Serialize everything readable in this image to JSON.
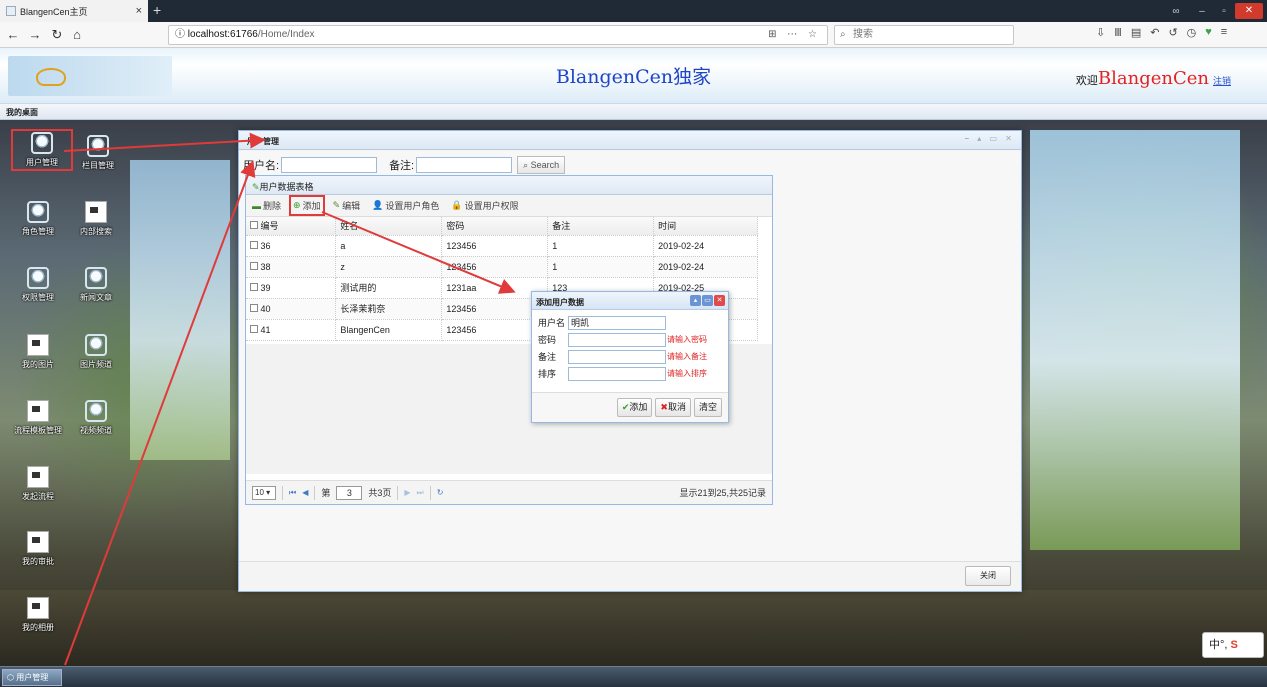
{
  "browser": {
    "tab_title": "BlangenCen主页",
    "url_host": "localhost",
    "url_port": ":61766",
    "url_path": "/Home/Index",
    "search_placeholder": "搜索"
  },
  "site": {
    "title": "BlangenCen独家",
    "welcome_prefix": "欢迎",
    "username": "BlangenCen",
    "logout": "注销",
    "desktop_label": "我的桌面"
  },
  "desktop_icons": [
    {
      "label": "用户管理",
      "icon": "cube-icon"
    },
    {
      "label": "栏目管理",
      "icon": "cube-icon"
    },
    {
      "label": "角色管理",
      "icon": "cube-icon"
    },
    {
      "label": "内部搜索",
      "icon": "document-icon"
    },
    {
      "label": "权限管理",
      "icon": "cube-icon"
    },
    {
      "label": "新闻文章",
      "icon": "cube-icon"
    },
    {
      "label": "我的图片",
      "icon": "document-icon"
    },
    {
      "label": "图片频道",
      "icon": "cube-icon"
    },
    {
      "label": "流程模板管理",
      "icon": "document-icon"
    },
    {
      "label": "视频频道",
      "icon": "cube-icon"
    },
    {
      "label": "发起流程",
      "icon": "document-icon"
    },
    {
      "label": "我的审批",
      "icon": "document-icon"
    },
    {
      "label": "我的相册",
      "icon": "document-icon"
    }
  ],
  "window": {
    "title": "用户管理",
    "search": {
      "username_label": "用户名:",
      "remark_label": "备注:",
      "search_button": "Search"
    },
    "grid": {
      "title": "用户数据表格",
      "toolbar": {
        "delete": "删除",
        "add": "添加",
        "edit": "编辑",
        "set_role": "设置用户角色",
        "set_permission": "设置用户权限"
      },
      "columns": [
        "编号",
        "姓名",
        "密码",
        "备注",
        "时间"
      ],
      "rows": [
        [
          "36",
          "a",
          "123456",
          "1",
          "2019-02-24"
        ],
        [
          "38",
          "z",
          "123456",
          "1",
          "2019-02-24"
        ],
        [
          "39",
          "测试用的",
          "1231aa",
          "123",
          "2019-02-25"
        ],
        [
          "40",
          "长泽茉莉奈",
          "123456",
          "",
          ""
        ],
        [
          "41",
          "BlangenCen",
          "123456",
          "",
          ""
        ]
      ],
      "pager": {
        "page_size": "10",
        "page_label": "第",
        "page": "3",
        "total_pages": "共3页",
        "info": "显示21到25,共25记录"
      }
    },
    "close_button": "关闭"
  },
  "dialog": {
    "title": "添加用户数据",
    "fields": [
      {
        "label": "用户名",
        "value": "明凯",
        "error": ""
      },
      {
        "label": "密码",
        "value": "",
        "error": "请输入密码"
      },
      {
        "label": "备注",
        "value": "",
        "error": "请输入备注"
      },
      {
        "label": "排序",
        "value": "",
        "error": "请输入排序"
      }
    ],
    "buttons": {
      "add": "添加",
      "cancel": "取消",
      "clear": "清空"
    }
  },
  "taskbar": {
    "item": "用户管理"
  },
  "ime": {
    "text": "中°,"
  },
  "colors": {
    "annotation": "#e03a3a",
    "accent": "#95b8e7",
    "title_blue": "#1e44c8",
    "user_red": "#e32222"
  }
}
